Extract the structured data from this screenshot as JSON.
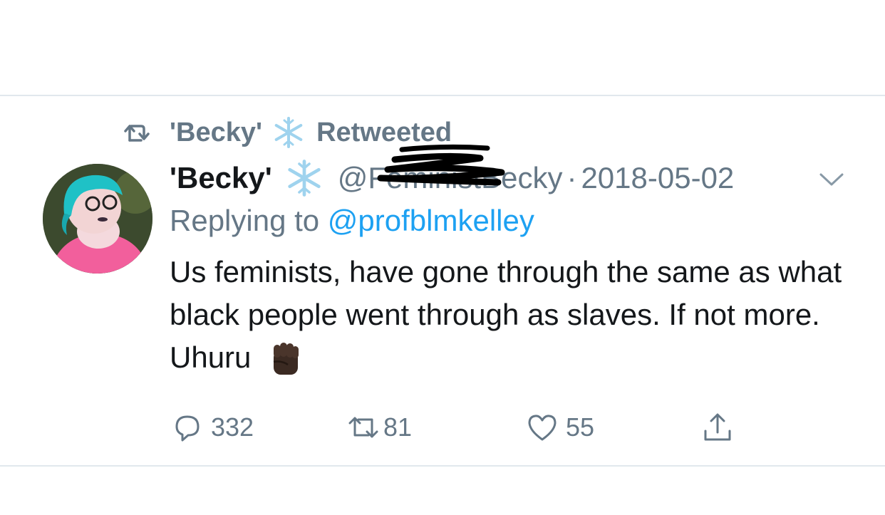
{
  "retweet_header": {
    "retweeter": "'Becky'",
    "label": "Retweeted"
  },
  "tweet": {
    "display_name": "'Becky'",
    "handle": "@FeministBecky",
    "separator": "·",
    "date": "2018-05-02",
    "replying_to_label": "Replying to",
    "replying_to_handle": "@profblmkelley",
    "text": "Us feminists, have gone through the same as what black people went through as slaves. If not more. Uhuru"
  },
  "actions": {
    "reply_count": "332",
    "retweet_count": "81",
    "like_count": "55"
  },
  "colors": {
    "muted": "#657786",
    "link": "#1da1f2",
    "text": "#14171a",
    "divider": "#e1e8ed"
  },
  "icons": [
    "retweet-icon",
    "snowflake-icon",
    "chevron-down-icon",
    "raised-fist-icon",
    "reply-icon",
    "like-icon",
    "share-icon"
  ]
}
